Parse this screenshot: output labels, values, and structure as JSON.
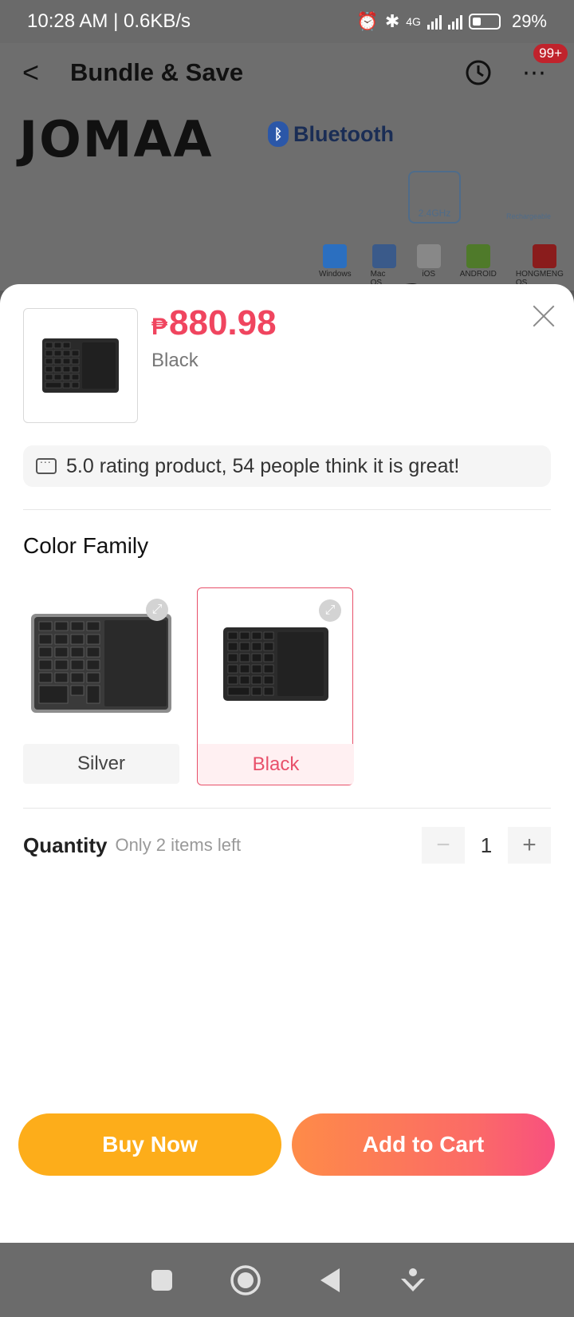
{
  "status_bar": {
    "time_speed": "10:28 AM | 0.6KB/s",
    "network_type": "4G",
    "battery": "29%"
  },
  "header": {
    "title": "Bundle & Save",
    "notification_count": "99+"
  },
  "banner": {
    "brand": "JOMAA",
    "bluetooth": "Bluetooth",
    "wifi_label": "2.4GHz",
    "recharge_label": "Rechargeable",
    "os": [
      "Windows",
      "Mac OS",
      "iOS",
      "ANDROID",
      "HONGMENG OS"
    ]
  },
  "product": {
    "currency": "₱",
    "price": "880.98",
    "selected_variant": "Black"
  },
  "rating": {
    "text": "5.0 rating product, 54 people think it is great!"
  },
  "color_family": {
    "title": "Color Family",
    "options": [
      {
        "label": "Silver",
        "selected": false
      },
      {
        "label": "Black",
        "selected": true
      }
    ]
  },
  "quantity": {
    "title": "Quantity",
    "stock_note": "Only 2 items left",
    "value": "1",
    "minus": "−",
    "plus": "+"
  },
  "actions": {
    "buy_now": "Buy Now",
    "add_to_cart": "Add to Cart"
  },
  "colors": {
    "price_red": "#f0455f",
    "buy_orange": "#fdad1a",
    "cart_gradient_start": "#fe8b48",
    "cart_gradient_end": "#f8507f",
    "selected_border": "#e8506a"
  }
}
